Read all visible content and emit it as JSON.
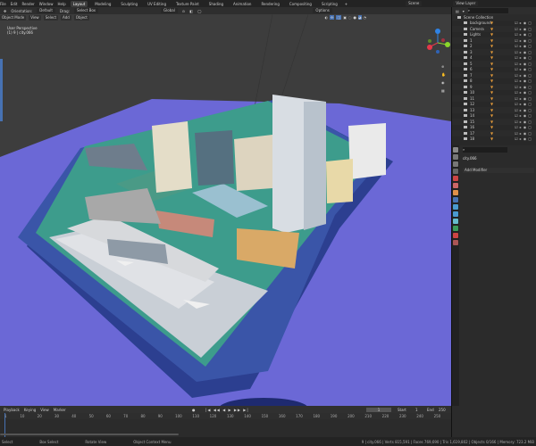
{
  "menu": [
    "File",
    "Edit",
    "Render",
    "Window",
    "Help"
  ],
  "workspaces": [
    "Layout",
    "Modeling",
    "Sculpting",
    "UV Editing",
    "Texture Paint",
    "Shading",
    "Animation",
    "Rendering",
    "Compositing",
    "Scripting"
  ],
  "scene": "Scene",
  "view_layer": "View Layer",
  "header": {
    "orientation": "Orientation:",
    "orientation_value": "Default",
    "drag": "Drag:",
    "drag_value": "Select Box",
    "transform": "Global",
    "options": "Options"
  },
  "viewport": {
    "mode": "Object Mode",
    "view": "View",
    "select": "Select",
    "add": "Add",
    "object": "Object",
    "title": "User Perspective",
    "subtitle": "(1) 9 | city.066"
  },
  "outliner": {
    "root": "Scene Collection",
    "items": [
      "background",
      "Camera",
      "Lights",
      "1",
      "2",
      "3",
      "4",
      "5",
      "6",
      "7",
      "8",
      "9",
      "10",
      "11",
      "12",
      "13",
      "14",
      "15",
      "16",
      "17",
      "18"
    ]
  },
  "properties": {
    "object": "city.066",
    "add_modifier": "Add Modifier"
  },
  "timeline": {
    "playback": "Playback",
    "keying": "Keying",
    "view": "View",
    "marker": "Marker",
    "current": "1",
    "start_label": "Start",
    "start": "1",
    "end_label": "End",
    "end": "250",
    "ticks": [
      "1",
      "10",
      "20",
      "30",
      "40",
      "50",
      "60",
      "70",
      "80",
      "90",
      "100",
      "110",
      "120",
      "130",
      "140",
      "150",
      "160",
      "170",
      "180",
      "190",
      "200",
      "210",
      "220",
      "230",
      "240",
      "250"
    ]
  },
  "status": {
    "select": "Select",
    "box": "Box Select",
    "rotate": "Rotate View",
    "context": "Object Context Menu",
    "stats": "9 | city.066 | Verts 815,591 | Faces 769,690 | Tris 1,619,802 | Objects 0/166 | Memory: 723.2 MiB"
  }
}
